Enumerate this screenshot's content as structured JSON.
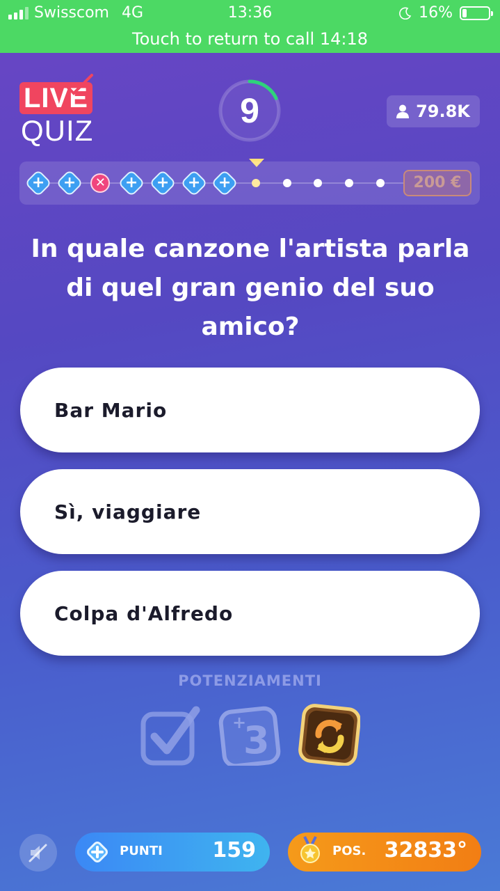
{
  "status_bar": {
    "carrier": "Swisscom",
    "network": "4G",
    "time": "13:36",
    "battery": "16%",
    "battery_level": 0.16,
    "call_banner": "Touch to return to call 14:18"
  },
  "logo": {
    "line1": "LIVE",
    "line2": "QUIZ"
  },
  "timer": {
    "value": "9",
    "remaining_fraction": 0.18
  },
  "viewers": "79.8K",
  "progress": {
    "steps": [
      "done",
      "done",
      "wrong",
      "done",
      "done",
      "done",
      "done",
      "current",
      "pending",
      "pending",
      "pending",
      "pending"
    ],
    "prize": "200 €"
  },
  "question": "In quale canzone l'artista parla di quel gran genio del suo amico?",
  "answers": [
    "Bar Mario",
    "Sì, viaggiare",
    "Colpa d'Alfredo"
  ],
  "powerups": {
    "title": "POTENZIAMENTI"
  },
  "bottom": {
    "points_label": "PUNTI",
    "points_value": "159",
    "position_label": "POS.",
    "position_value": "32833°"
  },
  "colors": {
    "status_green": "#4cd964",
    "live_red": "#f0455f",
    "points_blue": "#3b88f5",
    "position_orange": "#f59a1a",
    "timer_green": "#2ed47a"
  }
}
